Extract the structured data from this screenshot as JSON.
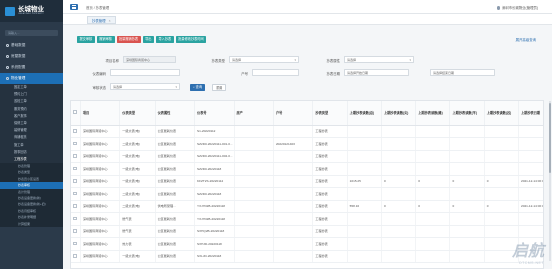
{
  "brand": {
    "name": "长城物业",
    "sub": "GREATWALL PROPERTY"
  },
  "sidebar": {
    "search_placeholder": "请输入...",
    "items": [
      {
        "label": "基础数据"
      },
      {
        "label": "房屋数据"
      },
      {
        "label": "系统配置"
      },
      {
        "label": "物业管理"
      }
    ],
    "subitems": [
      "固定工单",
      "预约上门",
      "巡检工单",
      "服务预约",
      "客户报事",
      "保修工单",
      "装修管理",
      "商铺租赁",
      "施工单",
      "报事回访",
      "工程抄表"
    ],
    "subsubitems": [
      "抄表管理",
      "抄表类型",
      "抄表员小区设置",
      "抄表审核",
      "表计管理",
      "抄表设备更换(新)",
      "抄表设备更换(新+旧)",
      "抄表月结审核",
      "抄表补录明细",
      "计算结果"
    ],
    "active_subsub": "抄表审核"
  },
  "header": {
    "breadcrumb": "首页 / 抄表管理",
    "user": "深圳市长城物业(管理员)",
    "tab_label": "抄表管理"
  },
  "toolbar": {
    "buttons": [
      "提交审核",
      "撤销审核",
      "批量撤销抄表",
      "导出",
      "导入抄表",
      "批量修改抄表时间"
    ],
    "filter_link": "展开高级查询"
  },
  "filters": {
    "project_label": "项目名称",
    "project_value": "深圳国际商贸中心",
    "meter_type_label": "抄表类型",
    "meter_type_value": "请选择",
    "meter_attr_label": "抄表属性",
    "meter_attr_value": "请选择",
    "meter_no_label": "仪表编码",
    "meter_no_placeholder": "",
    "account_label": "户号",
    "account_placeholder": "",
    "date_label": "抄表日期",
    "date_start": "请选择开始日期",
    "date_end": "请选择结束日期",
    "status_label": "审核状态",
    "status_value": "请选择",
    "query_btn": "查询",
    "reset_btn": "重置"
  },
  "table": {
    "headers": [
      "项目",
      "仪表类型",
      "仪表属性",
      "仪表号",
      "房产",
      "户号",
      "抄表类型",
      "上期抄表读数(总)",
      "上期抄表读数(尖)",
      "上期抄表读数(峰)",
      "上期抄表读数(平)",
      "上期抄表读数(谷)",
      "上期抄表日期"
    ],
    "rows": [
      [
        "深圳国际商贸中心",
        "一级大表(电)",
        "公区能耗仪表",
        "S1-20220112",
        "",
        "",
        "工程抄表",
        "",
        "",
        "",
        "",
        "",
        ""
      ],
      [
        "深圳国际商贸中心",
        "二级大表(电)",
        "公区能耗仪表",
        "SZ2D0-20220111-001-0...",
        "",
        "20220121403",
        "工程抄表",
        "",
        "",
        "",
        "",
        "",
        ""
      ],
      [
        "深圳国际商贸中心",
        "一级大表(电)",
        "公区能耗仪表",
        "SZ2D0-20220111-002-0...",
        "",
        "",
        "工程抄表",
        "",
        "",
        "",
        "",
        "",
        ""
      ],
      [
        "深圳国际商贸中心",
        "一级大表(电)",
        "公区能耗仪表",
        "SZ2D0-20220118",
        "",
        "",
        "工程抄表",
        "",
        "",
        "",
        "",
        "",
        ""
      ],
      [
        "深圳国际商贸中心",
        "一级大表(电)",
        "公区能耗仪表",
        "KFZT2S-20220114",
        "",
        "",
        "工程抄表",
        "1015.25",
        "0",
        "0",
        "0",
        "0",
        "2021-12-14 00:00"
      ],
      [
        "深圳国际商贸中心",
        "二级大表(电)",
        "公区能耗仪表",
        "SZ2D0-20220118",
        "",
        "",
        "工程抄表",
        "",
        "",
        "",
        "",
        "",
        ""
      ],
      [
        "深圳国际商贸中心",
        "二级大表(电)",
        "供电所受理...",
        "YXJ7D2B-20220118",
        "",
        "",
        "工程抄表",
        "558.16",
        "0",
        "0",
        "0",
        "0",
        "2021-12-14 00:00"
      ],
      [
        "深圳国际商贸中心",
        "燃气表",
        "公区能耗仪表",
        "YXJ7D2B-20220118",
        "",
        "",
        "工程抄表",
        "",
        "",
        "",
        "",
        "",
        ""
      ],
      [
        "深圳国际商贸中心",
        "燃气表",
        "公区能耗仪表",
        "SXHQ2B-20220118",
        "",
        "",
        "工程抄表",
        "",
        "",
        "",
        "",
        "",
        ""
      ],
      [
        "深圳国际商贸中心",
        "热力表",
        "公区能耗仪表",
        "SXHJD-20220118",
        "",
        "",
        "工程抄表",
        "",
        "",
        "",
        "",
        "",
        ""
      ],
      [
        "深圳国际商贸中心",
        "一级大表(电)",
        "公区能耗仪表",
        "SXLJD-20220118",
        "",
        "",
        "工程抄表",
        "",
        "",
        "",
        "",
        "",
        ""
      ]
    ]
  },
  "watermark": {
    "big": "启航",
    "small": "DTCMS.NET"
  },
  "colors": {
    "primary": "#2d6fb0",
    "teal": "#2aa3a1",
    "danger": "#d9534f",
    "sidebar": "#2b3a4a"
  }
}
